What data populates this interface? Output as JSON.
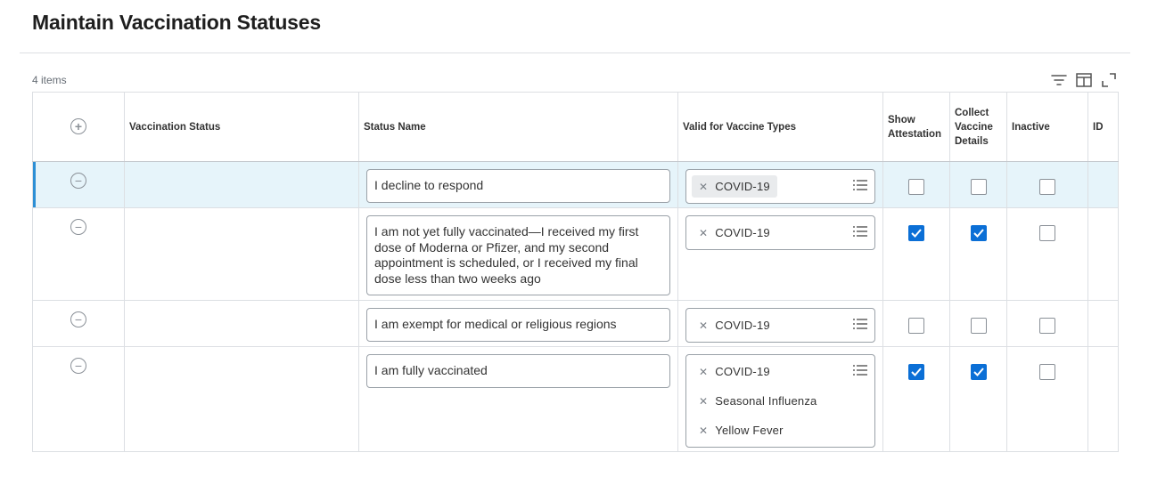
{
  "page": {
    "title": "Maintain Vaccination Statuses"
  },
  "grid": {
    "item_count": "4 items",
    "toolbar": {
      "filter_icon": "filter-icon",
      "columns_icon": "columns-icon",
      "fullscreen_icon": "expand-icon"
    },
    "columns": {
      "add": "add-row",
      "vaccination_status": "Vaccination Status",
      "status_name": "Status Name",
      "valid_for": "Valid for Vaccine Types",
      "show_attestation": "Show Attestation",
      "collect_details": "Collect Vaccine Details",
      "inactive": "Inactive",
      "id": "ID"
    },
    "rows": [
      {
        "status_name": "I decline to respond",
        "vaccine_types": [
          "COVID-19"
        ],
        "show_attestation": false,
        "collect_details": false,
        "inactive": false,
        "selected": true
      },
      {
        "status_name": "I am not yet fully vaccinated—I received my first dose of Moderna or Pfizer, and my second appointment is scheduled, or I received my final dose less than two weeks ago",
        "vaccine_types": [
          "COVID-19"
        ],
        "show_attestation": true,
        "collect_details": true,
        "inactive": false,
        "selected": false
      },
      {
        "status_name": "I am exempt for medical or religious regions",
        "vaccine_types": [
          "COVID-19"
        ],
        "show_attestation": false,
        "collect_details": false,
        "inactive": false,
        "selected": false
      },
      {
        "status_name": "I am fully vaccinated",
        "vaccine_types": [
          "COVID-19",
          "Seasonal Influenza",
          "Yellow Fever"
        ],
        "show_attestation": true,
        "collect_details": true,
        "inactive": false,
        "selected": false
      }
    ]
  },
  "colors": {
    "accent": "#0b6fd6",
    "selected_row": "#e6f4fa",
    "selected_bar": "#2d8fd5"
  }
}
